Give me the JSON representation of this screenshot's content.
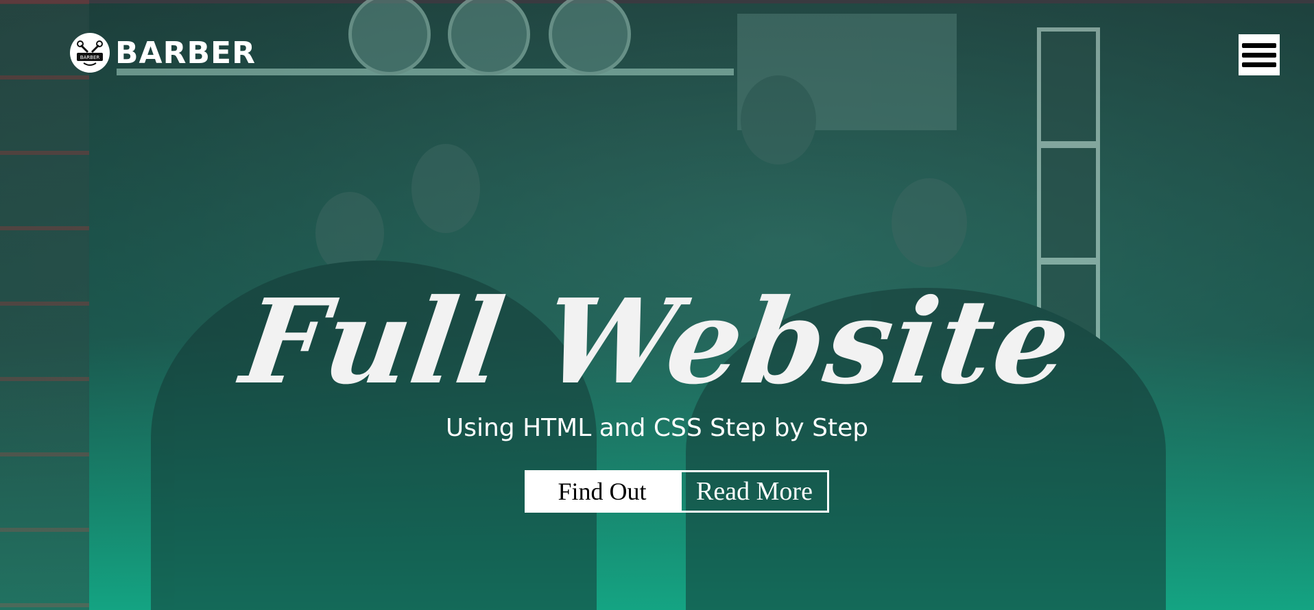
{
  "brand": {
    "name": "BARBER",
    "badge_text": "BARBER"
  },
  "nav": {
    "menu_icon": "hamburger-menu-icon"
  },
  "hero": {
    "headline": "Full Website",
    "subheadline": "Using HTML and CSS Step by Step",
    "primary_button": "Find Out",
    "secondary_button": "Read More"
  },
  "colors": {
    "accent": "#19a985",
    "text": "#ffffff"
  }
}
